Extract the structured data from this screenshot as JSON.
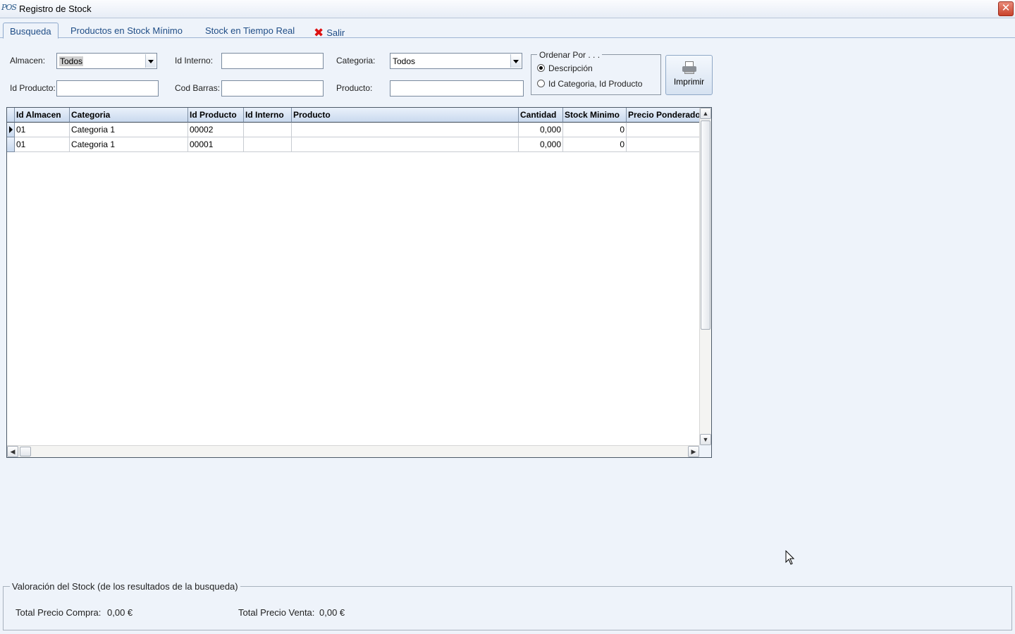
{
  "window": {
    "title": "Registro de Stock",
    "app_icon_text": "POS",
    "close_symbol": "✕"
  },
  "tabs": [
    {
      "label": "Busqueda",
      "active": true
    },
    {
      "label": "Productos en Stock Mínimo"
    },
    {
      "label": "Stock en Tiempo Real"
    },
    {
      "label": "Salir",
      "icon": "close-x-icon"
    }
  ],
  "filters": {
    "almacen": {
      "label": "Almacen:",
      "value": "Todos"
    },
    "id_interno": {
      "label": "Id Interno:",
      "value": ""
    },
    "categoria": {
      "label": "Categoria:",
      "value": "Todos"
    },
    "id_producto": {
      "label": "Id Producto:",
      "value": ""
    },
    "cod_barras": {
      "label": "Cod Barras:",
      "value": ""
    },
    "producto": {
      "label": "Producto:",
      "value": ""
    }
  },
  "ordenar": {
    "legend": "Ordenar Por . . .",
    "options": [
      "Descripción",
      "Id Categoria, Id Producto"
    ],
    "selected": "Descripción"
  },
  "print_button": {
    "label": "Imprimir",
    "icon": "printer-icon"
  },
  "table": {
    "columns": [
      "Id Almacen",
      "Categoria",
      "Id Producto",
      "Id Interno",
      "Producto",
      "Cantidad",
      "Stock Minimo",
      "Precio Ponderado"
    ],
    "rows": [
      [
        "01",
        "Categoria 1",
        "00002",
        "",
        "",
        "0,000",
        "0",
        ""
      ],
      [
        "01",
        "Categoria 1",
        "00001",
        "",
        "",
        "0,000",
        "0",
        ""
      ]
    ]
  },
  "valuation": {
    "legend": "Valoración del Stock (de los resultados de la busqueda)",
    "compra_label": "Total Precio Compra:",
    "compra_value": "0,00 €",
    "venta_label": "Total Precio Venta:",
    "venta_value": "0,00 €"
  },
  "colors": {
    "background": "#eef3fa",
    "tab_text": "#1f4d86",
    "close_red": "#c9432c",
    "header_blue": "#c9d9ee"
  }
}
